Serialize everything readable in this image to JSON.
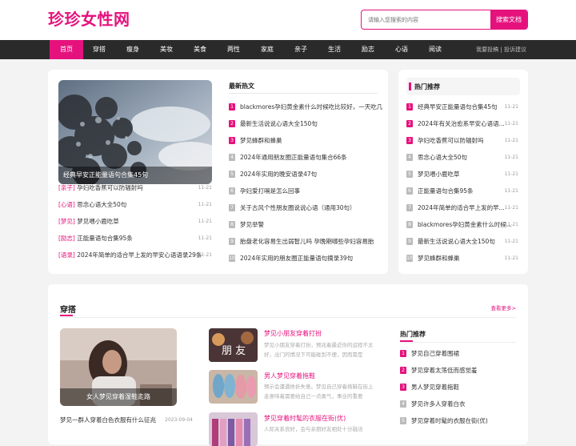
{
  "header": {
    "logo": "珍珍女性网",
    "search_placeholder": "请输入您搜索的内容",
    "search_button": "搜索文档"
  },
  "nav": {
    "items": [
      "首页",
      "穿搭",
      "瘦身",
      "美妆",
      "美食",
      "两性",
      "家庭",
      "亲子",
      "生活",
      "励志",
      "心语",
      "阅读"
    ],
    "active": 0,
    "right_links": [
      "我要投稿",
      "投诉建议"
    ]
  },
  "featured": {
    "caption": "经典早安正能量语句合集45句",
    "list": [
      {
        "tag": "[亲子]",
        "title": "孕妇吃香蕉可以防辐射吗",
        "date": "11-21"
      },
      {
        "tag": "[心语]",
        "title": "思念心语大全50句",
        "date": "11-21"
      },
      {
        "tag": "[梦见]",
        "title": "梦见喂小鹿吃草",
        "date": "11-21"
      },
      {
        "tag": "[励志]",
        "title": "正能量语句合集95条",
        "date": "11-21"
      },
      {
        "tag": "[语录]",
        "title": "2024年简单的适合早上发的早安心语语录29条",
        "date": "11-21"
      }
    ]
  },
  "latest": {
    "heading": "最新热文",
    "items": [
      "blackmores孕妇黄金素什么时候吃比较好，一天吃几",
      "最新生活说说心语大全150句",
      "梦见蜂群和蜂巢",
      "2024年通用朋友圈正能量语句集合66条",
      "2024年实用的晚安语录47句",
      "孕妇爱打嗝是怎么回事",
      "关于古风个性朋友圈说说心语（通用30句）",
      "梦见举警",
      "胎盘老化容易生出弱智儿吗 孕晚期哪些孕妇容易胎",
      "2024年实用的朋友圈正能量语句摘录39句"
    ]
  },
  "hot": {
    "heading": "热门推荐",
    "items": [
      {
        "title": "经典早安正能量语句合集45句",
        "date": "11-21"
      },
      {
        "title": "2024年有关治愈系早安心语语...",
        "date": "11-21"
      },
      {
        "title": "孕妇吃香蕉可以防辐射吗",
        "date": "11-21"
      },
      {
        "title": "思念心语大全50句",
        "date": "11-21"
      },
      {
        "title": "梦见喂小鹿吃草",
        "date": "11-21"
      },
      {
        "title": "正能量语句合集95条",
        "date": "11-21"
      },
      {
        "title": "2024年简单的适合早上发的早...",
        "date": "11-21"
      },
      {
        "title": "blackmores孕妇黄金素什么时候...",
        "date": "11-21"
      },
      {
        "title": "最新生活说说心语大全150句",
        "date": "11-21"
      },
      {
        "title": "梦见蜂群和蜂巢",
        "date": "11-21"
      }
    ]
  },
  "section": {
    "title": "穿搭",
    "more": "查看更多>",
    "feature_caption": "女人梦见穿着湿鞋走路",
    "bottom_item": {
      "title": "梦见一群人穿着白色衣服有什么征兆",
      "date": "2023-09-04"
    },
    "articles": [
      {
        "title": "梦见小朋友穿着打扮",
        "desc": "梦见小朋友穿着打扮，预兆着最近你的运程不太好，出门的情况下可能碰到不便，因而需是"
      },
      {
        "title": "男人梦见穿着拖鞋",
        "desc": "预示会遭遇挫折失意。梦见自己穿着拖鞋在街上走意味着需要给自己一点勇气，事业的重要"
      },
      {
        "title": "梦见穿着时髦的衣服在街(优)",
        "desc": "人际关系良好，会与亲朋好友相处十分融洽"
      }
    ],
    "hot_heading": "热门推荐",
    "hot_items": [
      "梦见自己穿着围裙",
      "梦见穿着太荡低而感觉羞",
      "男人梦见穿着拖鞋",
      "梦见许多人穿着白衣",
      "梦见穿着时髦的衣服在街(优)"
    ]
  },
  "colors": {
    "accent": "#e5127d",
    "nav_bg": "#2a2a2a"
  }
}
